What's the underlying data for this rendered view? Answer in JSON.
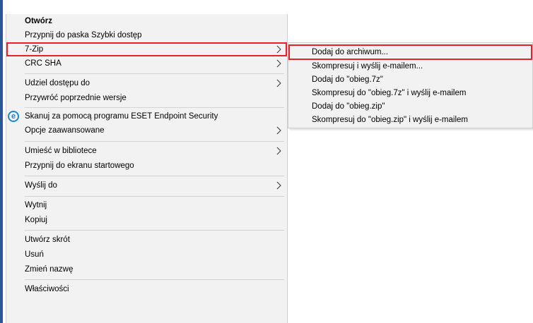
{
  "context_menu": {
    "items": [
      {
        "label": "Otwórz"
      },
      {
        "label": "Przypnij do paska Szybki dostęp"
      },
      {
        "label": "7-Zip"
      },
      {
        "label": "CRC SHA"
      },
      {
        "label": "Udziel dostępu do"
      },
      {
        "label": "Przywróć poprzednie wersje"
      },
      {
        "label": "Skanuj za pomocą programu ESET Endpoint Security"
      },
      {
        "label": "Opcje zaawansowane"
      },
      {
        "label": "Umieść w bibliotece"
      },
      {
        "label": "Przypnij do ekranu startowego"
      },
      {
        "label": "Wyślij do"
      },
      {
        "label": "Wytnij"
      },
      {
        "label": "Kopiuj"
      },
      {
        "label": "Utwórz skrót"
      },
      {
        "label": "Usuń"
      },
      {
        "label": "Zmień nazwę"
      },
      {
        "label": "Właściwości"
      }
    ],
    "eset_icon_glyph": "e"
  },
  "submenu_7zip": {
    "items": [
      {
        "label": "Dodaj do archiwum..."
      },
      {
        "label": "Skompresuj i wyślij e-mailem..."
      },
      {
        "label": "Dodaj do \"obieg.7z\""
      },
      {
        "label": "Skompresuj do \"obieg.7z\" i wyślij e-mailem"
      },
      {
        "label": "Dodaj do \"obieg.zip\""
      },
      {
        "label": "Skompresuj do \"obieg.zip\" i wyślij e-mailem"
      }
    ]
  },
  "colors": {
    "menu_bg": "#f2f2f2",
    "highlight_outline": "#e8202a",
    "eset_blue": "#1e88c8",
    "window_edge": "#2b5797"
  }
}
